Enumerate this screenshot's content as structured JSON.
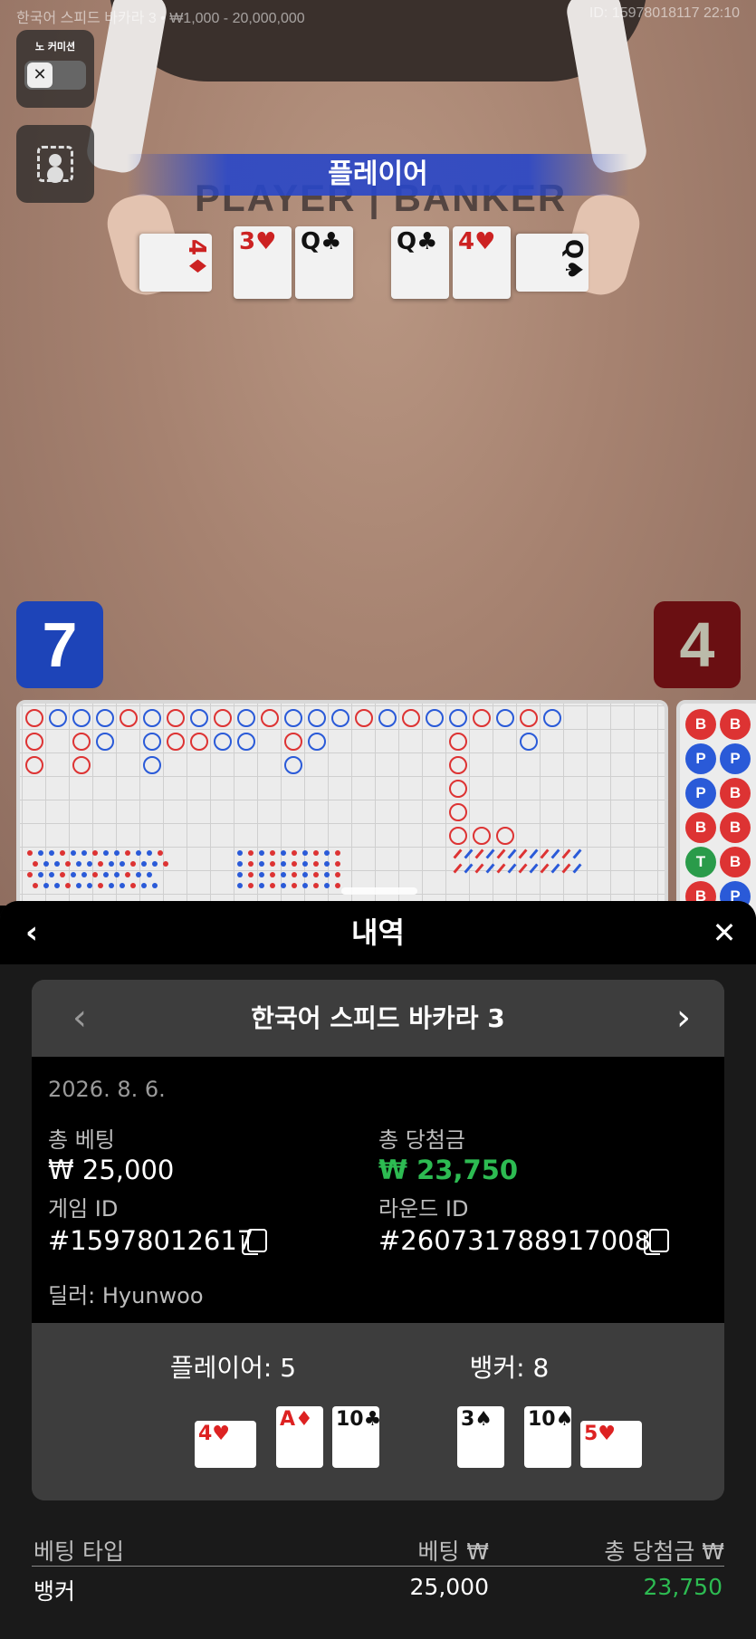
{
  "table_info": "한국어 스피드 바카라 3 • ₩1,000 - 20,000,000",
  "session_info": "ID: 15978018117 22:10",
  "no_commission_label": "노 커미션",
  "toggle_symbol": "✕",
  "winner_banner": "플레이어",
  "table_print": "PLAYER | BANKER",
  "live_cards": {
    "player": [
      "4♦",
      "3♥",
      "Q♣"
    ],
    "banker": [
      "Q♣",
      "4♥",
      "Q♠"
    ]
  },
  "live_scores": {
    "player": "7",
    "banker": "4"
  },
  "bead_road": [
    "B",
    "B",
    "P",
    "P",
    "P",
    "B",
    "B",
    "B",
    "T",
    "B",
    "B",
    "P"
  ],
  "colors": {
    "player": "#2a5ad8",
    "banker": "#d33333",
    "tie": "#2a9b4a",
    "win_green": "#2dbb52"
  },
  "history": {
    "title": "내역",
    "back_icon": "chevron-left-icon",
    "close_icon": "close-icon",
    "game_name": "한국어 스피드 바카라 3",
    "date": "2026. 8. 6.",
    "total_bet_label": "총 베팅",
    "total_bet_value": "₩ 25,000",
    "total_win_label": "총 당첨금",
    "total_win_value": "₩ 23,750",
    "game_id_label": "게임 ID",
    "game_id_value": "#15978012617",
    "round_id_label": "라운드 ID",
    "round_id_value": "#260731788917008",
    "dealer": "딜러: Hyunwoo",
    "player_result": "플레이어: 5",
    "banker_result": "뱅커: 8",
    "player_cards": [
      {
        "rank": "4",
        "suit": "♥",
        "color": "red"
      },
      {
        "rank": "A",
        "suit": "♦",
        "color": "red"
      },
      {
        "rank": "10",
        "suit": "♣",
        "color": "black"
      }
    ],
    "banker_cards": [
      {
        "rank": "3",
        "suit": "♠",
        "color": "black"
      },
      {
        "rank": "10",
        "suit": "♠",
        "color": "black"
      },
      {
        "rank": "5",
        "suit": "♥",
        "color": "red"
      }
    ],
    "table_headers": [
      "베팅 타입",
      "베팅 ₩",
      "총 당첨금 ₩"
    ],
    "bets": [
      {
        "type": "뱅커",
        "bet": "25,000",
        "win": "23,750"
      }
    ]
  }
}
